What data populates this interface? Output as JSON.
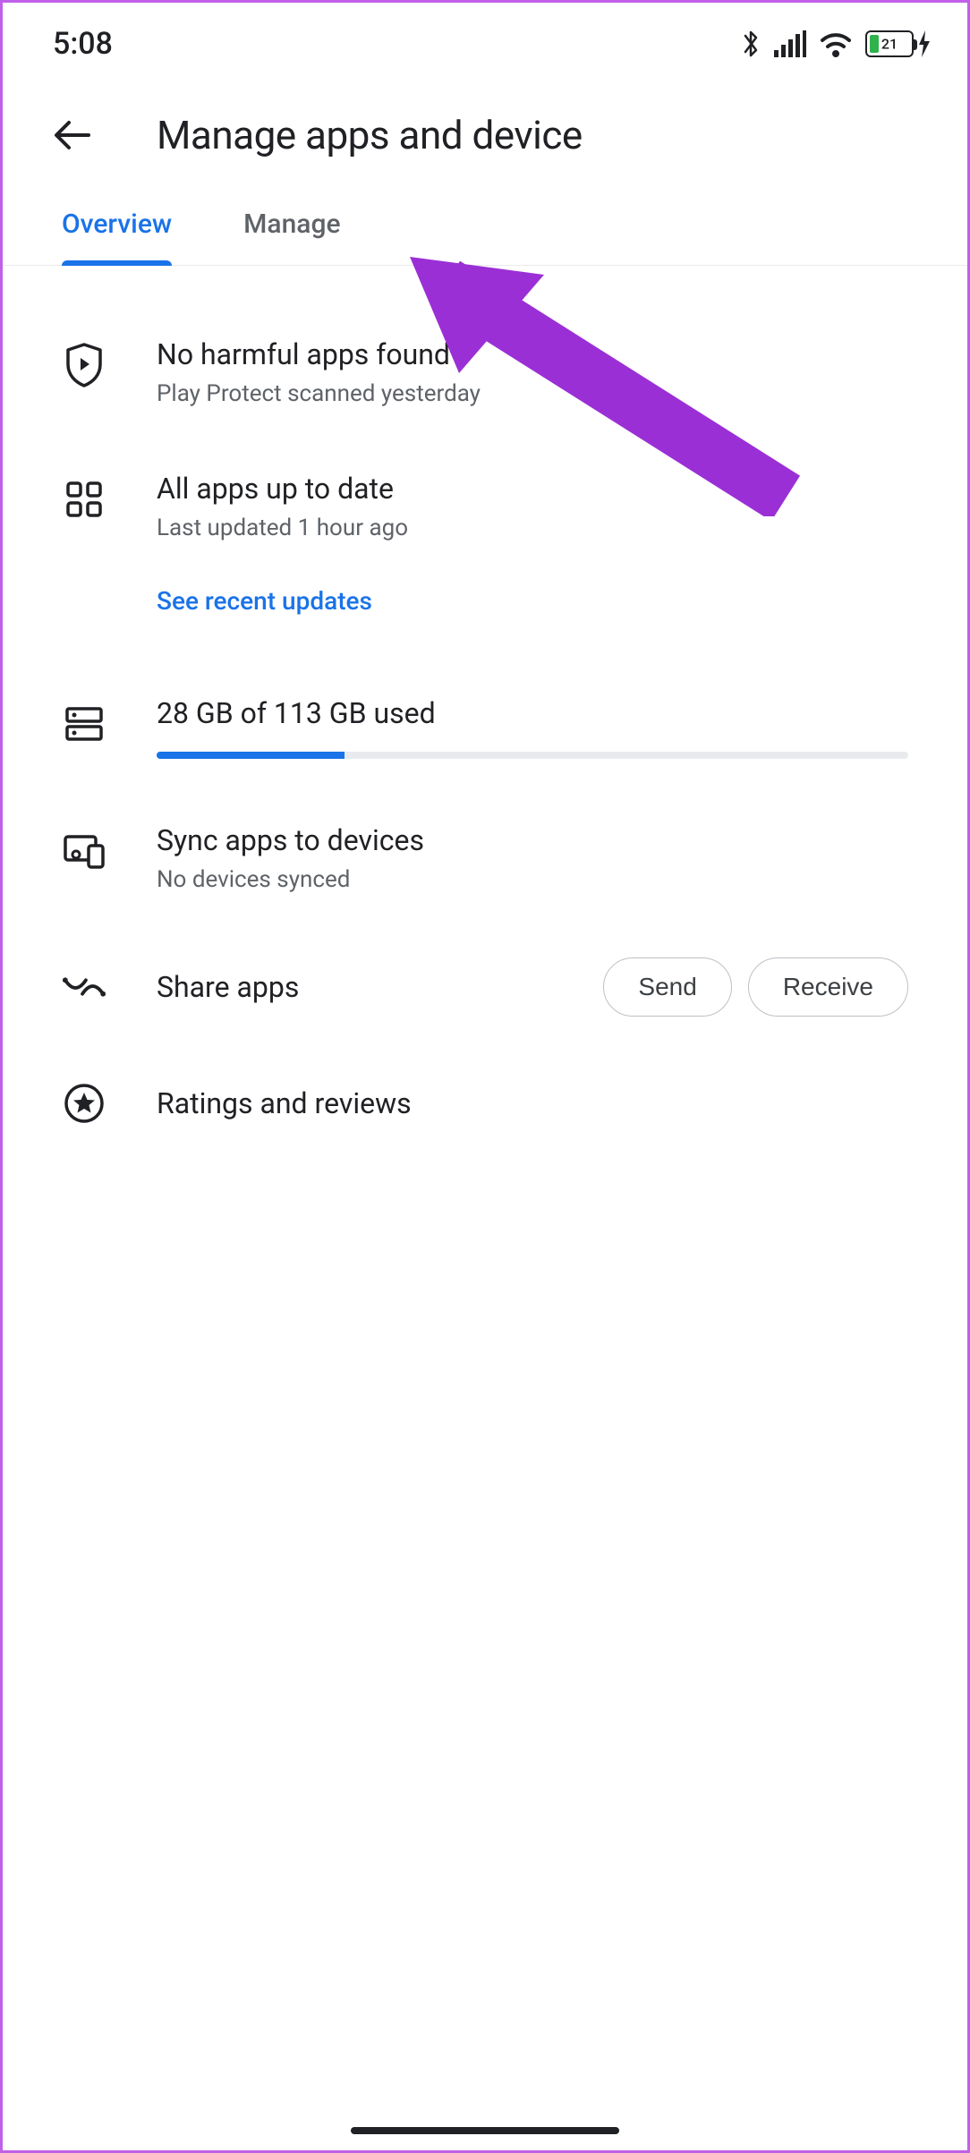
{
  "status": {
    "time": "5:08",
    "battery_pct": "21"
  },
  "header": {
    "title": "Manage apps and device"
  },
  "tabs": [
    {
      "label": "Overview",
      "active": true
    },
    {
      "label": "Manage",
      "active": false
    }
  ],
  "rows": {
    "protect": {
      "title": "No harmful apps found",
      "sub": "Play Protect scanned yesterday"
    },
    "updates": {
      "title": "All apps up to date",
      "sub": "Last updated 1 hour ago",
      "link": "See recent updates"
    },
    "storage": {
      "title": "28 GB of 113 GB used"
    },
    "sync": {
      "title": "Sync apps to devices",
      "sub": "No devices synced"
    },
    "share": {
      "title": "Share apps",
      "send": "Send",
      "receive": "Receive"
    },
    "ratings": {
      "title": "Ratings and reviews"
    }
  }
}
